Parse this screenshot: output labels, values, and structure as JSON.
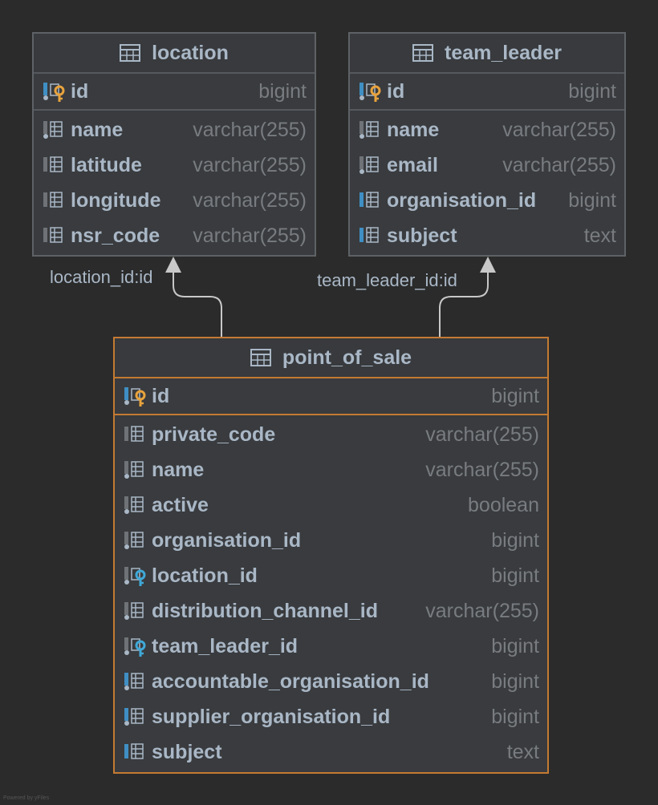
{
  "tables": {
    "location": {
      "title": "location",
      "pk": {
        "name": "id",
        "type": "bigint"
      },
      "columns": [
        {
          "name": "name",
          "type": "varchar(255)"
        },
        {
          "name": "latitude",
          "type": "varchar(255)"
        },
        {
          "name": "longitude",
          "type": "varchar(255)"
        },
        {
          "name": "nsr_code",
          "type": "varchar(255)"
        }
      ]
    },
    "team_leader": {
      "title": "team_leader",
      "pk": {
        "name": "id",
        "type": "bigint"
      },
      "columns": [
        {
          "name": "name",
          "type": "varchar(255)"
        },
        {
          "name": "email",
          "type": "varchar(255)"
        },
        {
          "name": "organisation_id",
          "type": "bigint"
        },
        {
          "name": "subject",
          "type": "text"
        }
      ]
    },
    "point_of_sale": {
      "title": "point_of_sale",
      "pk": {
        "name": "id",
        "type": "bigint"
      },
      "columns": [
        {
          "name": "private_code",
          "type": "varchar(255)"
        },
        {
          "name": "name",
          "type": "varchar(255)"
        },
        {
          "name": "active",
          "type": "boolean"
        },
        {
          "name": "organisation_id",
          "type": "bigint"
        },
        {
          "name": "location_id",
          "type": "bigint"
        },
        {
          "name": "distribution_channel_id",
          "type": "varchar(255)"
        },
        {
          "name": "team_leader_id",
          "type": "bigint"
        },
        {
          "name": "accountable_organisation_id",
          "type": "bigint"
        },
        {
          "name": "supplier_organisation_id",
          "type": "bigint"
        },
        {
          "name": "subject",
          "type": "text"
        }
      ]
    }
  },
  "relations": {
    "location": "location_id:id",
    "team_leader": "team_leader_id:id"
  },
  "footer": "Powered by yFiles",
  "colors": {
    "background": "#2b2b2b",
    "selected_border": "#c47a32",
    "pk_key": "#e8a33d",
    "fk_key": "#3fa9d8",
    "column_blue": "#3f8fc4"
  },
  "icons": {
    "table": "table-icon",
    "primary_key": "primary-key-icon",
    "foreign_key": "foreign-key-icon",
    "column": "column-icon"
  }
}
